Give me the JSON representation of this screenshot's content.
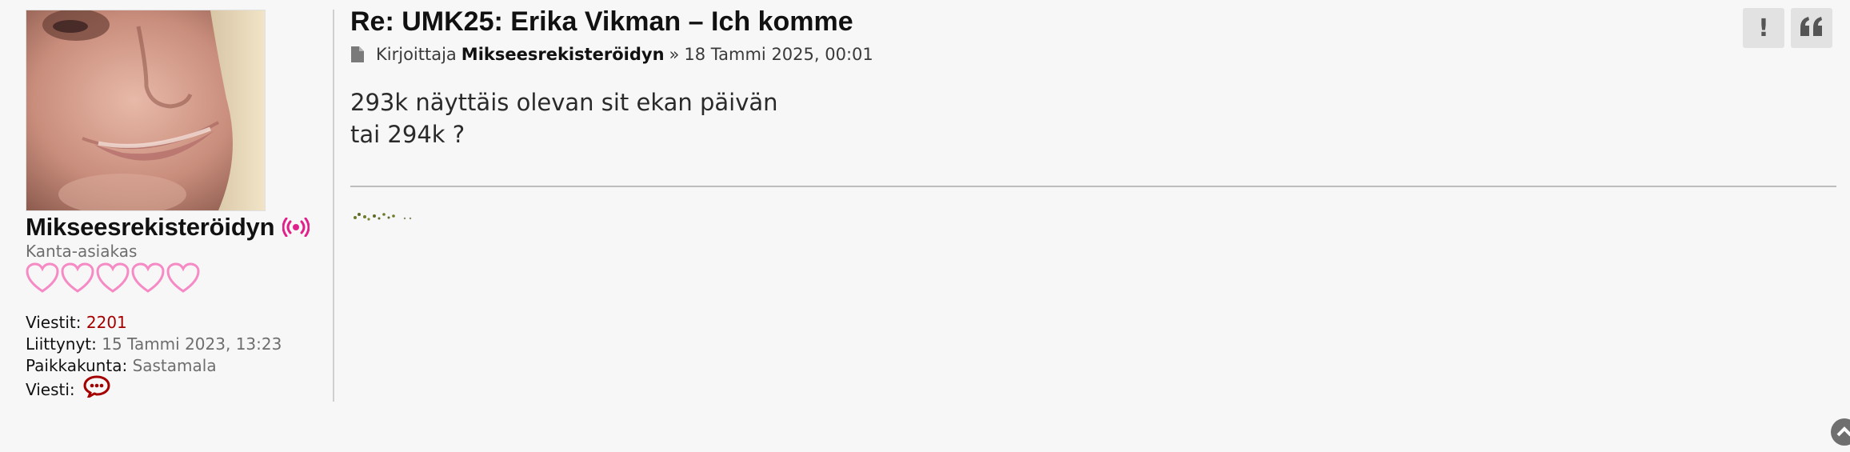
{
  "profile": {
    "username": "Mikseesrekisteröidyn",
    "rank": "Kanta-asiakas",
    "hearts_count": 5,
    "stats": {
      "posts_label": "Viestit:",
      "posts_value": "2201",
      "joined_label": "Liittynyt:",
      "joined_value": "15 Tammi 2023, 13:23",
      "location_label": "Paikkakunta:",
      "location_value": "Sastamala",
      "message_label": "Viesti:"
    },
    "icons": [
      "online-indicator-icon",
      "heart-rank-icon",
      "speech-bubble-icon"
    ]
  },
  "post": {
    "title": "Re: UMK25: Erika Vikman – Ich komme",
    "meta": {
      "by_label": "Kirjoittaja",
      "author": "Mikseesrekisteröidyn",
      "separator": "»",
      "date": "18 Tammi 2025, 00:01"
    },
    "content_lines": [
      "293k näyttäis olevan sit ekan päivän",
      "tai 294k ?"
    ]
  },
  "actions": {
    "report_glyph": "!",
    "quote_glyph": "❝"
  },
  "colors": {
    "accent_pink": "#e0218a",
    "heart_pink": "#f58ac5",
    "stat_red": "#a40000",
    "background": "#f7f7f7"
  }
}
